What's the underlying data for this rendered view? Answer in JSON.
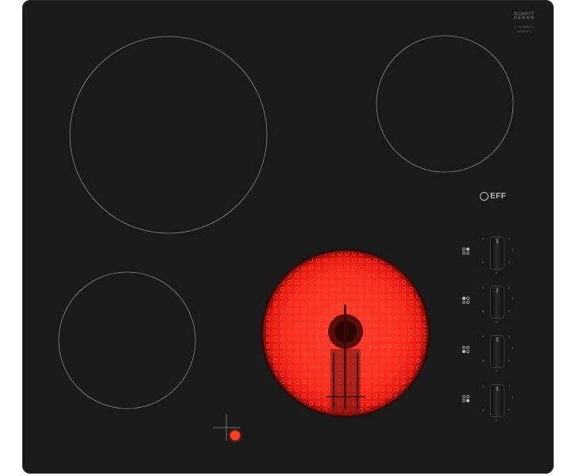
{
  "product": {
    "glass_brand_line1": "SCHOTT",
    "glass_brand_line2": "CERAN",
    "model_code": "TL 6100000 3",
    "serial_code": "MDS300 4",
    "brand_logo_text": "EFF"
  },
  "zones": [
    {
      "id": "rear-left",
      "state": "off"
    },
    {
      "id": "rear-right",
      "state": "off"
    },
    {
      "id": "front-left",
      "state": "off"
    },
    {
      "id": "front-right",
      "state": "on"
    }
  ],
  "controls": {
    "knob_count": 4,
    "scale_labels": [
      "0",
      "1",
      "2",
      "3",
      "4",
      "5",
      "6",
      "7",
      "8",
      "9"
    ]
  },
  "colors": {
    "glass": "#1b1a1a",
    "zone_outline": "#8a8888",
    "hot_zone": "#ff2a1c",
    "indicator": "#ff3e22"
  }
}
